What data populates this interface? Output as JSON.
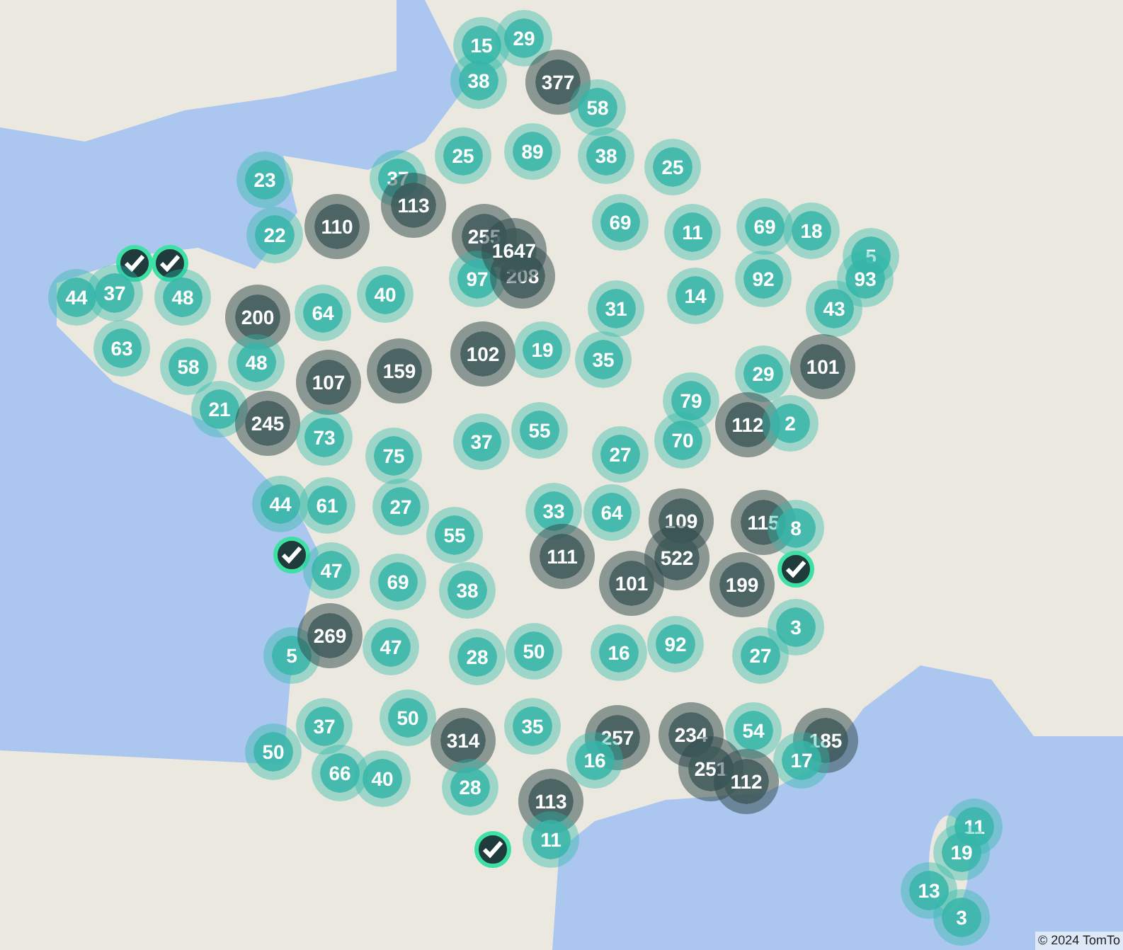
{
  "map": {
    "markers": [
      {
        "kind": "cluster",
        "label": "15"
      },
      {
        "kind": "cluster",
        "label": "29"
      },
      {
        "kind": "cluster",
        "label": "38"
      },
      {
        "kind": "large",
        "label": "377"
      },
      {
        "kind": "cluster",
        "label": "58"
      },
      {
        "kind": "cluster",
        "label": "25"
      },
      {
        "kind": "cluster",
        "label": "89"
      },
      {
        "kind": "cluster",
        "label": "38"
      },
      {
        "kind": "cluster",
        "label": "25"
      },
      {
        "kind": "cluster",
        "label": "23"
      },
      {
        "kind": "cluster",
        "label": "37"
      },
      {
        "kind": "large",
        "label": "113"
      },
      {
        "kind": "cluster",
        "label": "22"
      },
      {
        "kind": "large",
        "label": "110"
      },
      {
        "kind": "large",
        "label": "255"
      },
      {
        "kind": "cluster",
        "label": "69"
      },
      {
        "kind": "cluster",
        "label": "11"
      },
      {
        "kind": "cluster",
        "label": "69"
      },
      {
        "kind": "cluster",
        "label": "18"
      },
      {
        "kind": "cluster",
        "label": "97"
      },
      {
        "kind": "large",
        "label": "1647"
      },
      {
        "kind": "large",
        "label": "208"
      },
      {
        "kind": "cluster",
        "label": "5"
      },
      {
        "kind": "cluster",
        "label": "93"
      },
      {
        "kind": "check"
      },
      {
        "kind": "check"
      },
      {
        "kind": "cluster",
        "label": "44"
      },
      {
        "kind": "cluster",
        "label": "37"
      },
      {
        "kind": "cluster",
        "label": "48"
      },
      {
        "kind": "large",
        "label": "200"
      },
      {
        "kind": "cluster",
        "label": "64"
      },
      {
        "kind": "cluster",
        "label": "40"
      },
      {
        "kind": "cluster",
        "label": "31"
      },
      {
        "kind": "cluster",
        "label": "14"
      },
      {
        "kind": "cluster",
        "label": "92"
      },
      {
        "kind": "cluster",
        "label": "43"
      },
      {
        "kind": "cluster",
        "label": "63"
      },
      {
        "kind": "large",
        "label": "102"
      },
      {
        "kind": "cluster",
        "label": "19"
      },
      {
        "kind": "cluster",
        "label": "35"
      },
      {
        "kind": "cluster",
        "label": "58"
      },
      {
        "kind": "cluster",
        "label": "48"
      },
      {
        "kind": "large",
        "label": "107"
      },
      {
        "kind": "large",
        "label": "159"
      },
      {
        "kind": "cluster",
        "label": "29"
      },
      {
        "kind": "large",
        "label": "101"
      },
      {
        "kind": "cluster",
        "label": "21"
      },
      {
        "kind": "large",
        "label": "245"
      },
      {
        "kind": "cluster",
        "label": "79"
      },
      {
        "kind": "large",
        "label": "112"
      },
      {
        "kind": "cluster",
        "label": "2"
      },
      {
        "kind": "cluster",
        "label": "73"
      },
      {
        "kind": "cluster",
        "label": "75"
      },
      {
        "kind": "cluster",
        "label": "37"
      },
      {
        "kind": "cluster",
        "label": "55"
      },
      {
        "kind": "cluster",
        "label": "27"
      },
      {
        "kind": "cluster",
        "label": "70"
      },
      {
        "kind": "cluster",
        "label": "44"
      },
      {
        "kind": "cluster",
        "label": "61"
      },
      {
        "kind": "cluster",
        "label": "27"
      },
      {
        "kind": "cluster",
        "label": "33"
      },
      {
        "kind": "cluster",
        "label": "64"
      },
      {
        "kind": "large",
        "label": "109"
      },
      {
        "kind": "large",
        "label": "115"
      },
      {
        "kind": "cluster",
        "label": "8"
      },
      {
        "kind": "check"
      },
      {
        "kind": "cluster",
        "label": "55"
      },
      {
        "kind": "large",
        "label": "111"
      },
      {
        "kind": "large",
        "label": "522"
      },
      {
        "kind": "cluster",
        "label": "47"
      },
      {
        "kind": "cluster",
        "label": "69"
      },
      {
        "kind": "cluster",
        "label": "38"
      },
      {
        "kind": "large",
        "label": "101"
      },
      {
        "kind": "large",
        "label": "199"
      },
      {
        "kind": "check"
      },
      {
        "kind": "cluster",
        "label": "3"
      },
      {
        "kind": "cluster",
        "label": "5"
      },
      {
        "kind": "large",
        "label": "269"
      },
      {
        "kind": "cluster",
        "label": "47"
      },
      {
        "kind": "cluster",
        "label": "28"
      },
      {
        "kind": "cluster",
        "label": "50"
      },
      {
        "kind": "cluster",
        "label": "16"
      },
      {
        "kind": "cluster",
        "label": "92"
      },
      {
        "kind": "cluster",
        "label": "27"
      },
      {
        "kind": "cluster",
        "label": "37"
      },
      {
        "kind": "cluster",
        "label": "50"
      },
      {
        "kind": "cluster",
        "label": "35"
      },
      {
        "kind": "large",
        "label": "314"
      },
      {
        "kind": "large",
        "label": "257"
      },
      {
        "kind": "large",
        "label": "234"
      },
      {
        "kind": "cluster",
        "label": "54"
      },
      {
        "kind": "large",
        "label": "185"
      },
      {
        "kind": "cluster",
        "label": "50"
      },
      {
        "kind": "cluster",
        "label": "66"
      },
      {
        "kind": "cluster",
        "label": "40"
      },
      {
        "kind": "cluster",
        "label": "28"
      },
      {
        "kind": "cluster",
        "label": "16"
      },
      {
        "kind": "large",
        "label": "251"
      },
      {
        "kind": "large",
        "label": "112"
      },
      {
        "kind": "cluster",
        "label": "17"
      },
      {
        "kind": "large",
        "label": "113"
      },
      {
        "kind": "check"
      },
      {
        "kind": "cluster",
        "label": "11"
      },
      {
        "kind": "cluster",
        "label": "11"
      },
      {
        "kind": "cluster",
        "label": "19"
      },
      {
        "kind": "cluster",
        "label": "13"
      },
      {
        "kind": "cluster",
        "label": "3"
      }
    ],
    "copyright": "© 2024 TomTo"
  }
}
